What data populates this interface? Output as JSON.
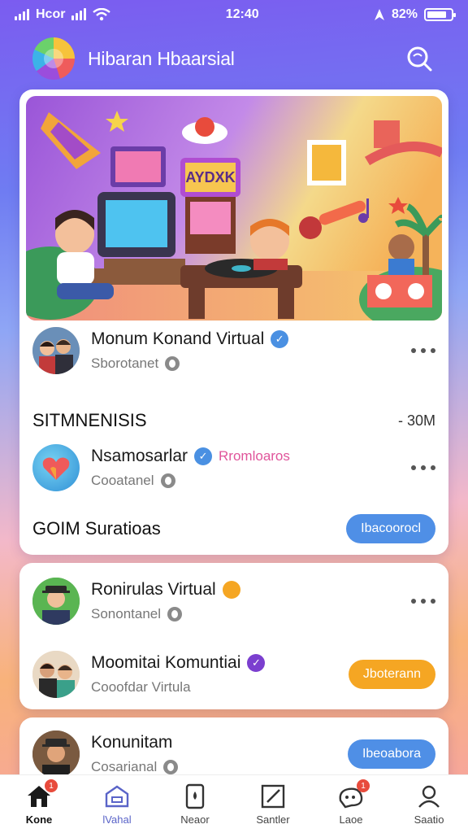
{
  "status_bar": {
    "carrier": "Hcor",
    "time": "12:40",
    "battery": "82%",
    "battery_level": 0.82
  },
  "header": {
    "title": "Hibaran Hbaarsial",
    "search_icon": "search-icon"
  },
  "feed": {
    "post": {
      "title": "Monum Konand Virtual",
      "subtitle": "Sborotanet",
      "verified_color": "#4a90e2"
    },
    "section": {
      "title": "SITMNENISIS",
      "meta": "- 30M"
    },
    "item": {
      "title": "Nsamosarlar",
      "tag": "Rromloaros",
      "subtitle": "Cooatanel"
    },
    "footer": {
      "title": "GOIM Suratioas",
      "button": "Ibacoorocl"
    }
  },
  "card_two": {
    "row1": {
      "title": "Ronirulas Virtual",
      "subtitle": "Sonontanel",
      "dot_color": "#f5a623"
    },
    "row2": {
      "title": "Moomitai Komuntiai",
      "subtitle": "Cooofdar Virtula",
      "button": "Jboterann",
      "verified_color": "#7b3fcf"
    }
  },
  "card_three": {
    "row1": {
      "title": "Konunitam",
      "subtitle": "Cosarianal",
      "button": "Ibeoabora"
    }
  },
  "nav": {
    "items": [
      {
        "label": "Kone",
        "icon": "home-icon",
        "badge": "1"
      },
      {
        "label": "lVahal",
        "icon": "store-icon"
      },
      {
        "label": "Neaor",
        "icon": "device-icon"
      },
      {
        "label": "Santler",
        "icon": "edit-icon"
      },
      {
        "label": "Laoe",
        "icon": "community-icon",
        "badge": "1"
      },
      {
        "label": "Saatio",
        "icon": "profile-icon"
      }
    ]
  }
}
